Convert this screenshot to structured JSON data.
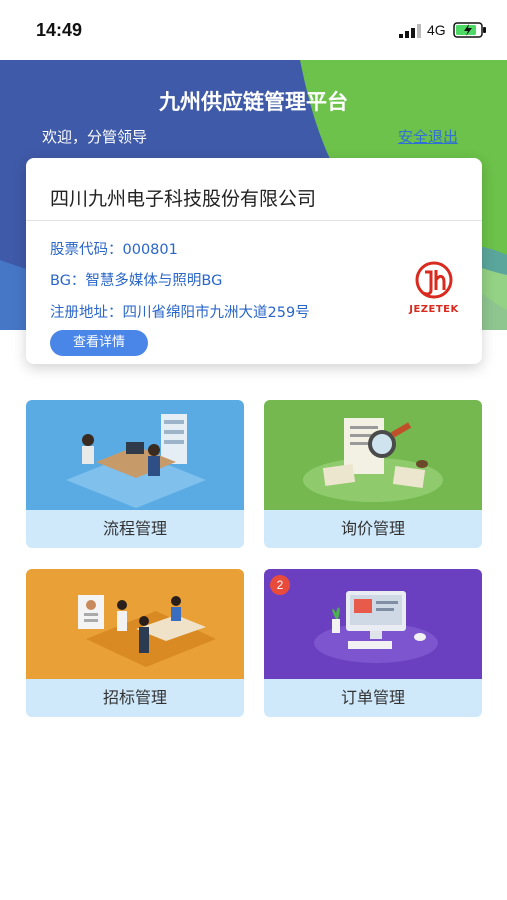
{
  "status_bar": {
    "time": "14:49",
    "network": "4G"
  },
  "header": {
    "title": "九州供应链管理平台",
    "welcome": "欢迎，分管领导",
    "logout_label": "安全退出"
  },
  "company_card": {
    "name": "四川九州电子科技股份有限公司",
    "stock_code": "股票代码：000801",
    "bg": "BG：智慧多媒体与照明BG",
    "address": "注册地址：四川省绵阳市九洲大道259号",
    "details_button": "查看详情",
    "logo_text": "JEZETEK"
  },
  "modules": [
    {
      "label": "流程管理",
      "color": "#5aabe3"
    },
    {
      "label": "询价管理",
      "color": "#74b84f"
    },
    {
      "label": "招标管理",
      "color": "#e9a036"
    },
    {
      "label": "订单管理",
      "color": "#6a3fc0",
      "badge": "2"
    }
  ],
  "colors": {
    "header_blue": "#3f5aa8",
    "header_green": "#6cc24a",
    "link": "#2f6fd6",
    "tile_label_bg": "#cfe9fb"
  }
}
